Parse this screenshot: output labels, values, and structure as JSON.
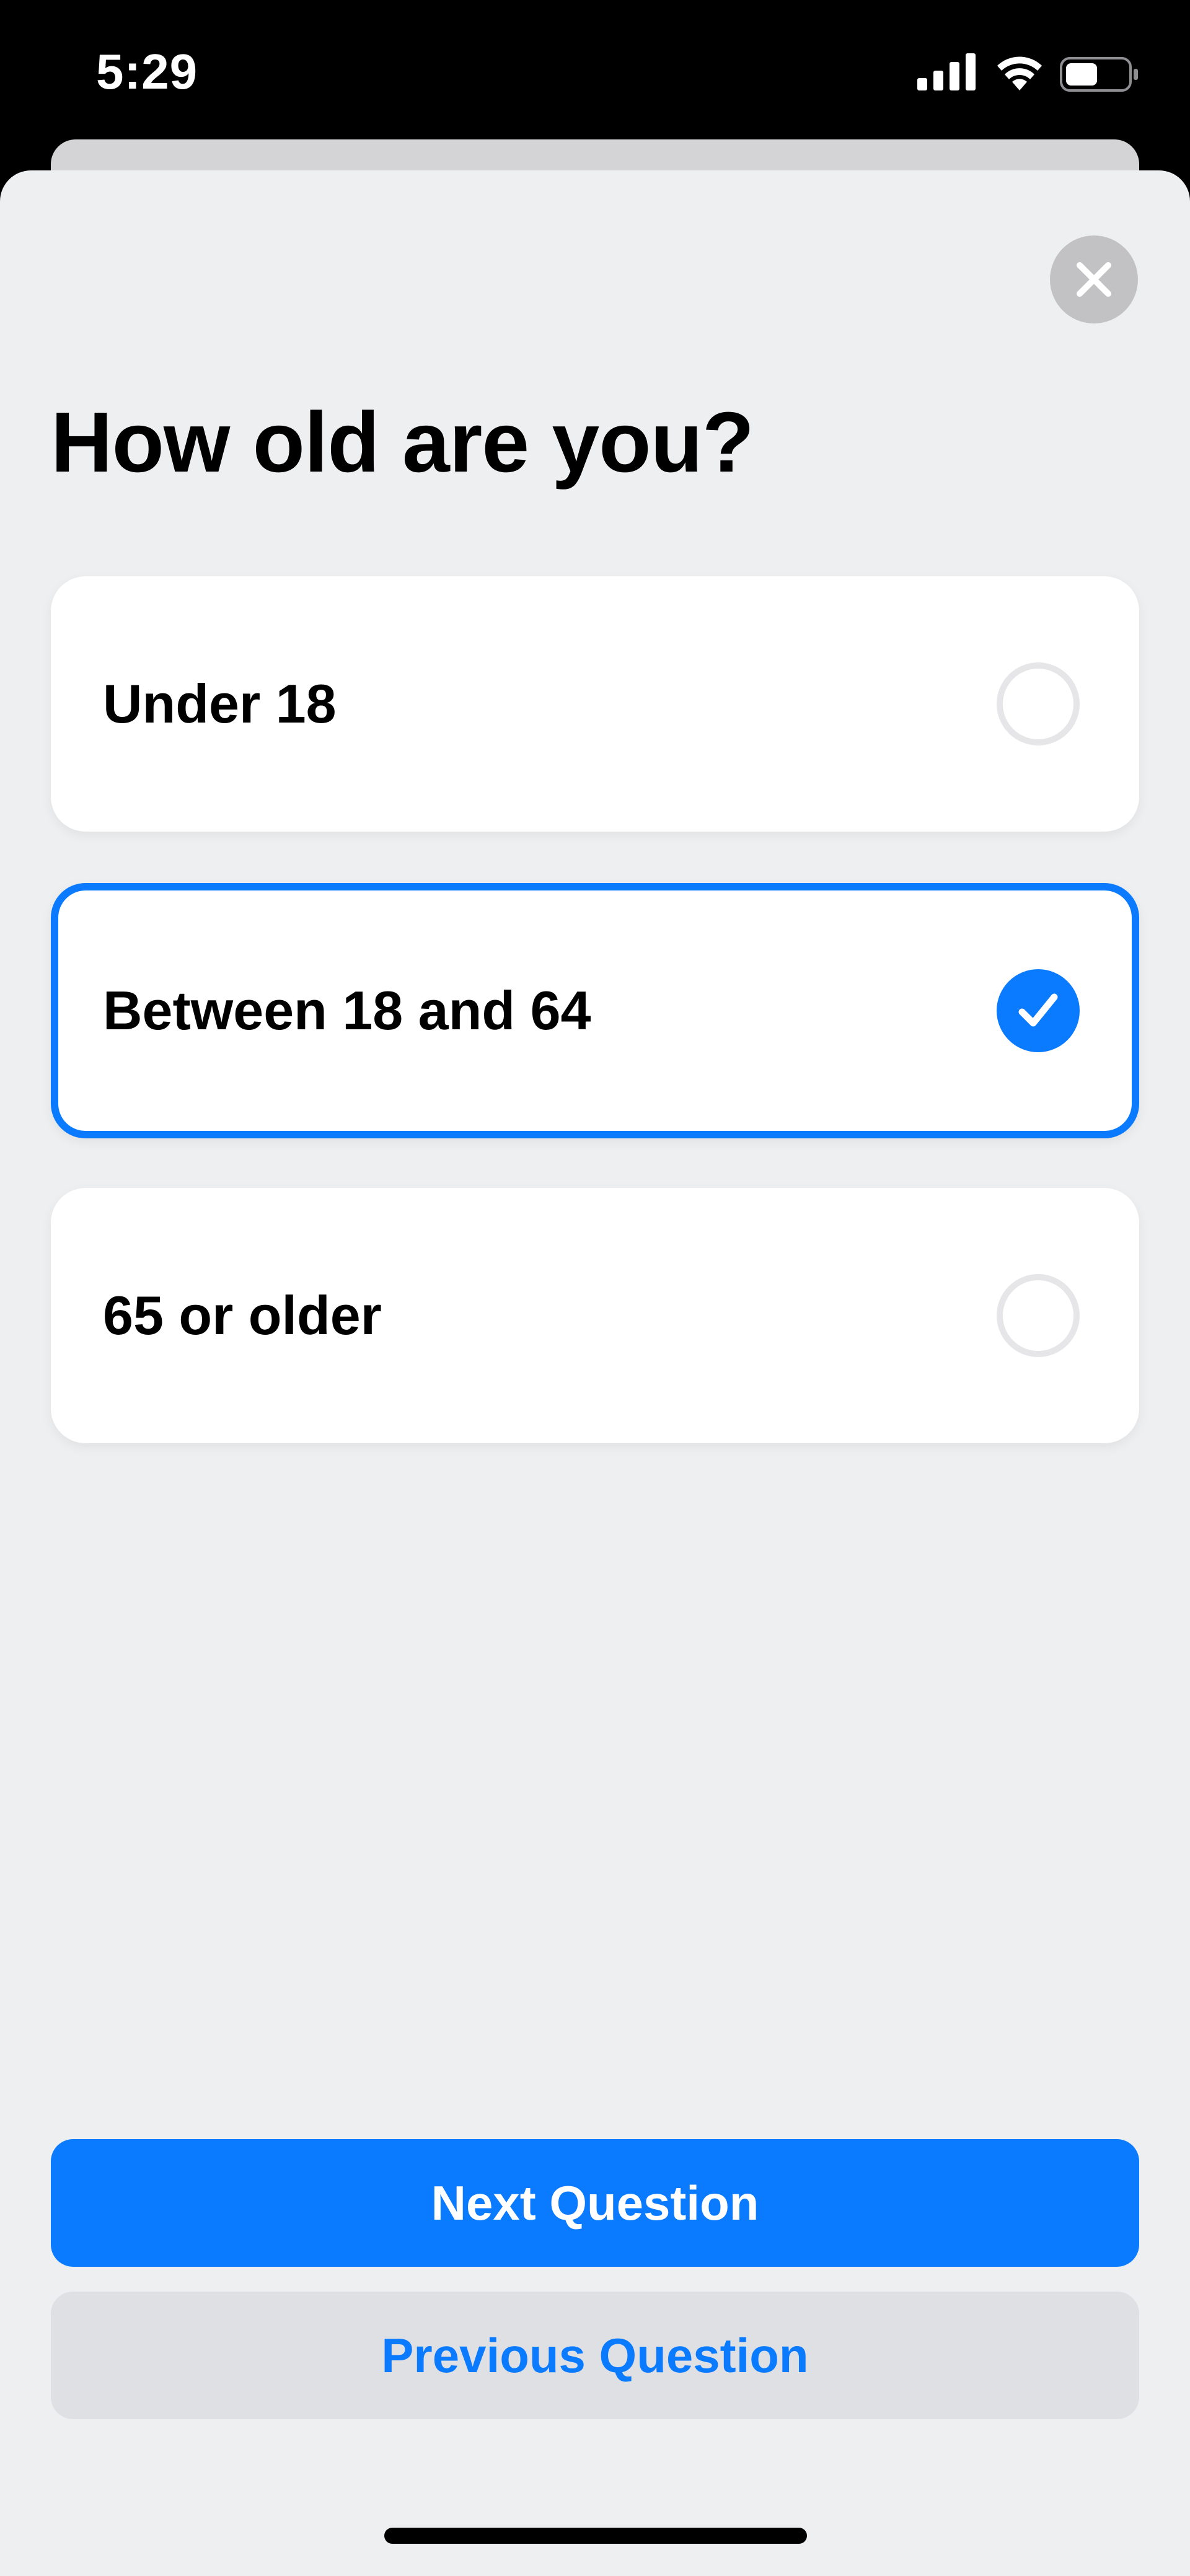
{
  "status_bar": {
    "time": "5:29",
    "icons": [
      "cellular-signal-icon",
      "wifi-icon",
      "battery-icon"
    ],
    "battery_level": 0.5
  },
  "sheet": {
    "close_icon": "close-icon",
    "title": "How old are you?",
    "options": [
      {
        "label": "Under 18",
        "selected": false
      },
      {
        "label": "Between 18 and 64",
        "selected": true
      },
      {
        "label": "65 or older",
        "selected": false
      }
    ],
    "next_button_label": "Next Question",
    "previous_button_label": "Previous Question"
  },
  "colors": {
    "accent": "#0a7aff",
    "sheet_background": "#eeeff1",
    "card_background": "#ffffff",
    "secondary_button": "#dfe0e3",
    "close_button": "#c2c2c4"
  }
}
